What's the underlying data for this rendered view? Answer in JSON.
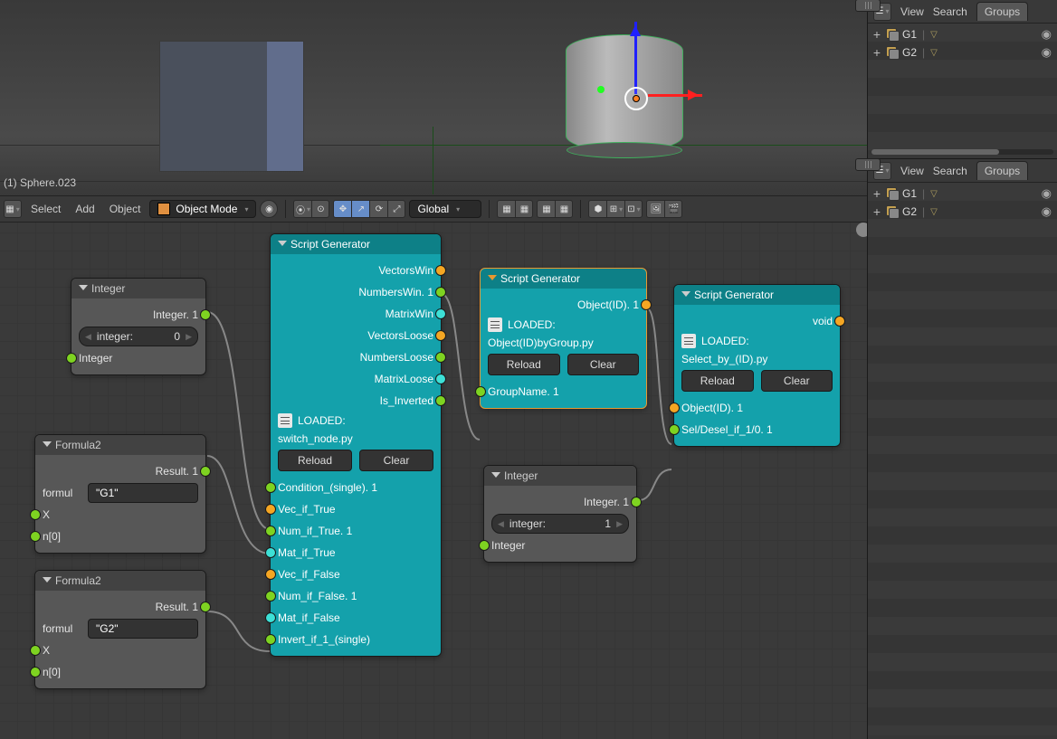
{
  "viewport": {
    "label": "(1) Sphere.023"
  },
  "header": {
    "menus": [
      "Select",
      "Add",
      "Object"
    ],
    "mode": "Object Mode",
    "orientation": "Global"
  },
  "nodes": {
    "integer1": {
      "title": "Integer",
      "out0": "Integer. 1",
      "field_label": "integer:",
      "field_value": "0",
      "in0": "Integer"
    },
    "formula1": {
      "title": "Formula2",
      "out0": "Result. 1",
      "field_label": "formul",
      "field_value": "\"G1\"",
      "in0": "X",
      "in1": "n[0]"
    },
    "formula2": {
      "title": "Formula2",
      "out0": "Result. 1",
      "field_label": "formul",
      "field_value": "\"G2\"",
      "in0": "X",
      "in1": "n[0]"
    },
    "script1": {
      "title": "Script Generator",
      "outputs": [
        "VectorsWin",
        "NumbersWin. 1",
        "MatrixWin",
        "VectorsLoose",
        "NumbersLoose",
        "MatrixLoose",
        "Is_Inverted"
      ],
      "loaded_label": "LOADED:",
      "loaded_file": "switch_node.py",
      "reload": "Reload",
      "clear": "Clear",
      "inputs": [
        "Condition_(single). 1",
        "Vec_if_True",
        "Num_if_True. 1",
        "Mat_if_True",
        "Vec_if_False",
        "Num_if_False. 1",
        "Mat_if_False",
        "Invert_if_1_(single)"
      ]
    },
    "script2": {
      "title": "Script Generator",
      "out0": "Object(ID). 1",
      "loaded_label": "LOADED:",
      "loaded_file": "Object(ID)byGroup.py",
      "reload": "Reload",
      "clear": "Clear",
      "in0": "GroupName. 1"
    },
    "integer2": {
      "title": "Integer",
      "out0": "Integer. 1",
      "field_label": "integer:",
      "field_value": "1",
      "in0": "Integer"
    },
    "script3": {
      "title": "Script Generator",
      "out0": "void",
      "loaded_label": "LOADED:",
      "loaded_file": "Select_by_(ID).py",
      "reload": "Reload",
      "clear": "Clear",
      "in0": "Object(ID). 1",
      "in1": "Sel/Desel_if_1/0. 1"
    }
  },
  "outliner": {
    "menus": [
      "View",
      "Search"
    ],
    "tab": "Groups",
    "items": [
      {
        "name": "G1"
      },
      {
        "name": "G2"
      }
    ]
  }
}
